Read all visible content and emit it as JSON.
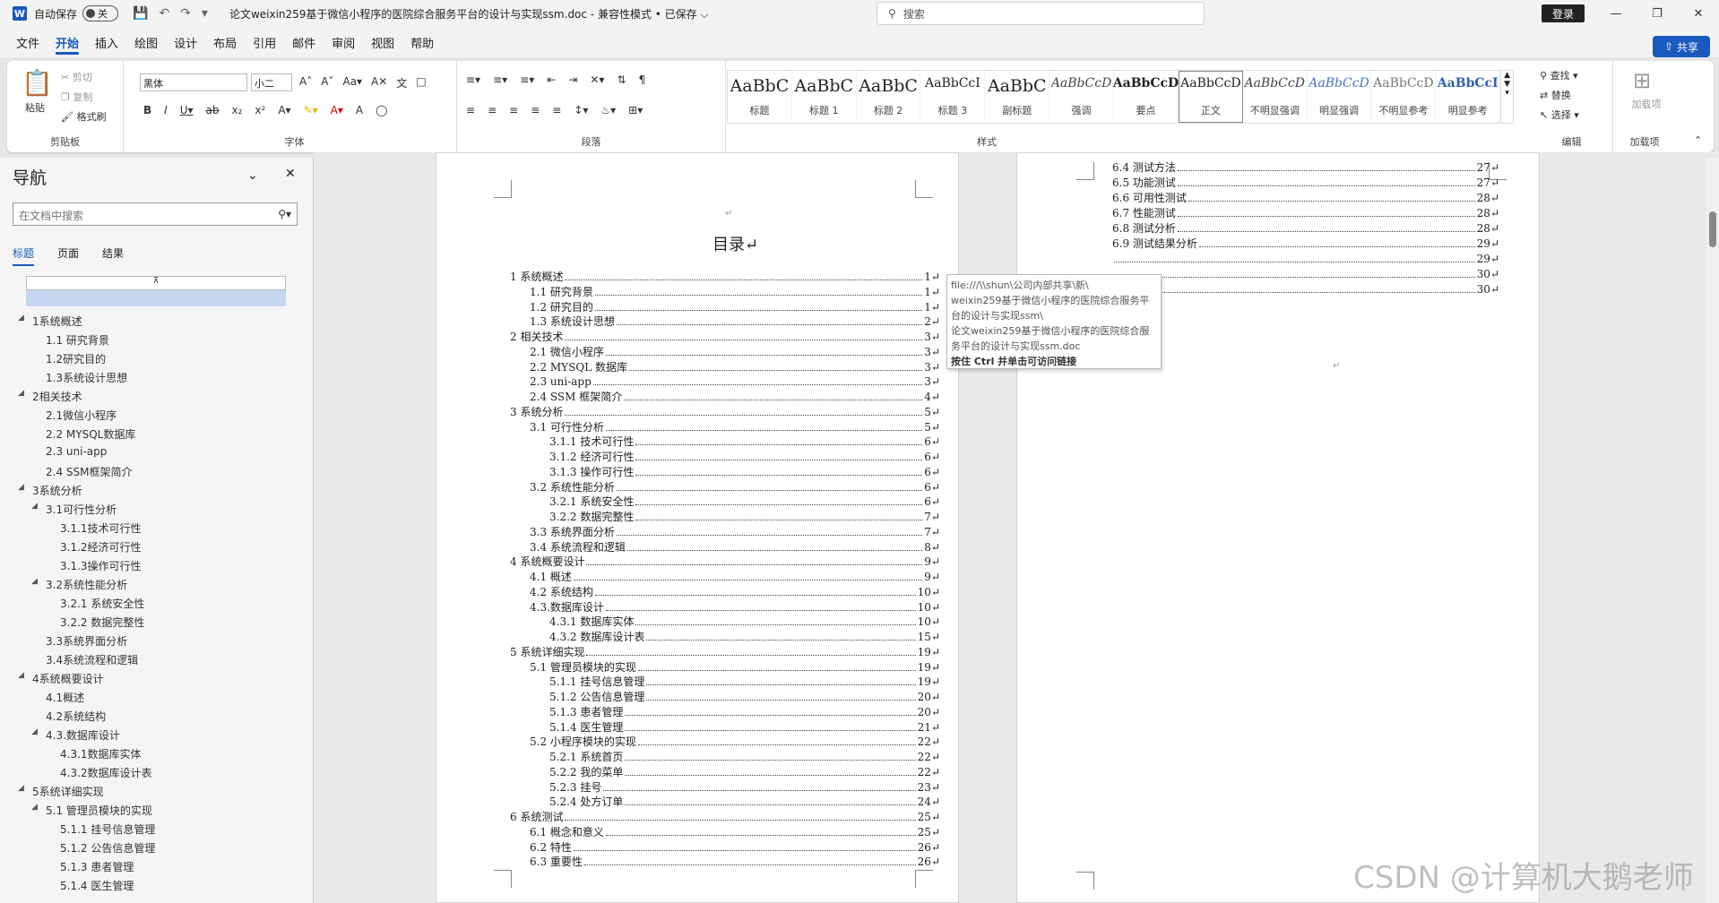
{
  "titlebar": {
    "autosave_label": "自动保存",
    "autosave_state": "关",
    "doc_title": "论文weixin259基于微信小程序的医院综合服务平台的设计与实现ssm.doc  -  兼容性模式 • 已保存 ⌵",
    "search_placeholder": "搜索",
    "login_label": "登录"
  },
  "menu": {
    "items": [
      "文件",
      "开始",
      "插入",
      "绘图",
      "设计",
      "布局",
      "引用",
      "邮件",
      "审阅",
      "视图",
      "帮助"
    ],
    "share_label": "共享"
  },
  "ribbon": {
    "clipboard": {
      "paste": "粘贴",
      "cut": "剪切",
      "copy": "复制",
      "format_painter": "格式刷",
      "label": "剪贴板"
    },
    "font": {
      "name": "黑体",
      "size": "小二",
      "label": "字体"
    },
    "paragraph": {
      "label": "段落"
    },
    "styles": {
      "label": "样式",
      "items": [
        {
          "sample": "AaBbC",
          "name": "标题"
        },
        {
          "sample": "AaBbC",
          "name": "标题 1"
        },
        {
          "sample": "AaBbC",
          "name": "标题 2"
        },
        {
          "sample": "AaBbCcI",
          "name": "标题 3"
        },
        {
          "sample": "AaBbC",
          "name": "副标题"
        },
        {
          "sample": "AaBbCcD",
          "name": "强调"
        },
        {
          "sample": "AaBbCcD",
          "name": "要点"
        },
        {
          "sample": "AaBbCcD",
          "name": "正文"
        },
        {
          "sample": "AaBbCcD",
          "name": "不明显强调"
        },
        {
          "sample": "AaBbCcD",
          "name": "明显强调"
        },
        {
          "sample": "AaBbCcD",
          "name": "不明显参考"
        },
        {
          "sample": "AaBbCcI",
          "name": "明显参考"
        }
      ]
    },
    "editing": {
      "find": "查找",
      "replace": "替换",
      "select": "选择",
      "label": "编辑"
    },
    "addins": {
      "btn": "加载项",
      "label": "加载项"
    }
  },
  "nav": {
    "title": "导航",
    "search_placeholder": "在文档中搜索",
    "tabs": [
      "标题",
      "页面",
      "结果"
    ],
    "items": [
      {
        "label": "1系统概述",
        "level": 1
      },
      {
        "label": "1.1 研究背景",
        "level": 2
      },
      {
        "label": "1.2研究目的",
        "level": 2
      },
      {
        "label": "1.3系统设计思想",
        "level": 2
      },
      {
        "label": "2相关技术",
        "level": 1
      },
      {
        "label": "2.1微信小程序",
        "level": 2
      },
      {
        "label": "2.2 MYSQL数据库",
        "level": 2
      },
      {
        "label": "2.3 uni-app",
        "level": 2
      },
      {
        "label": "2.4 SSM框架简介",
        "level": 2
      },
      {
        "label": "3系统分析",
        "level": 1
      },
      {
        "label": "3.1可行性分析",
        "level": 2
      },
      {
        "label": "3.1.1技术可行性",
        "level": 3
      },
      {
        "label": "3.1.2经济可行性",
        "level": 3
      },
      {
        "label": "3.1.3操作可行性",
        "level": 3
      },
      {
        "label": "3.2系统性能分析",
        "level": 2
      },
      {
        "label": "3.2.1 系统安全性",
        "level": 3
      },
      {
        "label": "3.2.2 数据完整性",
        "level": 3
      },
      {
        "label": "3.3系统界面分析",
        "level": 2
      },
      {
        "label": "3.4系统流程和逻辑",
        "level": 2
      },
      {
        "label": "4系统概要设计",
        "level": 1
      },
      {
        "label": "4.1概述",
        "level": 2
      },
      {
        "label": "4.2系统结构",
        "level": 2
      },
      {
        "label": "4.3.数据库设计",
        "level": 2
      },
      {
        "label": "4.3.1数据库实体",
        "level": 3
      },
      {
        "label": "4.3.2数据库设计表",
        "level": 3
      },
      {
        "label": "5系统详细实现",
        "level": 1
      },
      {
        "label": "5.1 管理员模块的实现",
        "level": 2
      },
      {
        "label": "5.1.1 挂号信息管理",
        "level": 3
      },
      {
        "label": "5.1.2 公告信息管理",
        "level": 3
      },
      {
        "label": "5.1.3 患者管理",
        "level": 3
      },
      {
        "label": "5.1.4 医生管理",
        "level": 3
      }
    ]
  },
  "page1": {
    "title": "目录↵",
    "toc": [
      {
        "t": "1 系统概述",
        "p": "1↵",
        "l": 1
      },
      {
        "t": "1.1  研究背景",
        "p": "1↵",
        "l": 2
      },
      {
        "t": "1.2 研究目的",
        "p": "1↵",
        "l": 2
      },
      {
        "t": "1.3 系统设计思想",
        "p": "2↵",
        "l": 2
      },
      {
        "t": "2 相关技术",
        "p": "3↵",
        "l": 1
      },
      {
        "t": "2.1 微信小程序",
        "p": "3↵",
        "l": 2
      },
      {
        "t": "2.2 MYSQL 数据库",
        "p": "3↵",
        "l": 2
      },
      {
        "t": "2.3 uni-app",
        "p": "3↵",
        "l": 2
      },
      {
        "t": "2.4 SSM 框架简介",
        "p": "4↵",
        "l": 2
      },
      {
        "t": "3 系统分析",
        "p": "5↵",
        "l": 1
      },
      {
        "t": "3.1 可行性分析",
        "p": "5↵",
        "l": 2
      },
      {
        "t": "3.1.1 技术可行性",
        "p": "6↵",
        "l": 3
      },
      {
        "t": "3.1.2 经济可行性",
        "p": "6↵",
        "l": 3
      },
      {
        "t": "3.1.3 操作可行性",
        "p": "6↵",
        "l": 3
      },
      {
        "t": "3.2 系统性能分析",
        "p": "6↵",
        "l": 2
      },
      {
        "t": "3.2.1  系统安全性",
        "p": "6↵",
        "l": 3
      },
      {
        "t": "3.2.2  数据完整性",
        "p": "7↵",
        "l": 3
      },
      {
        "t": "3.3 系统界面分析",
        "p": "7↵",
        "l": 2
      },
      {
        "t": "3.4 系统流程和逻辑",
        "p": "8↵",
        "l": 2
      },
      {
        "t": "4 系统概要设计",
        "p": "9↵",
        "l": 1
      },
      {
        "t": "4.1 概述",
        "p": "9↵",
        "l": 2
      },
      {
        "t": "4.2 系统结构",
        "p": "10↵",
        "l": 2
      },
      {
        "t": "4.3.数据库设计",
        "p": "10↵",
        "l": 2
      },
      {
        "t": "4.3.1 数据库实体",
        "p": "10↵",
        "l": 3
      },
      {
        "t": "4.3.2 数据库设计表",
        "p": "15↵",
        "l": 3
      },
      {
        "t": "5 系统详细实现",
        "p": "19↵",
        "l": 1
      },
      {
        "t": "5.1  管理员模块的实现",
        "p": "19↵",
        "l": 2
      },
      {
        "t": "5.1.1  挂号信息管理",
        "p": "19↵",
        "l": 3
      },
      {
        "t": "5.1.2  公告信息管理",
        "p": "20↵",
        "l": 3
      },
      {
        "t": "5.1.3  患者管理",
        "p": "20↵",
        "l": 3
      },
      {
        "t": "5.1.4  医生管理",
        "p": "21↵",
        "l": 3
      },
      {
        "t": "5.2  小程序模块的实现",
        "p": "22↵",
        "l": 2
      },
      {
        "t": "5.2.1  系统首页",
        "p": "22↵",
        "l": 3
      },
      {
        "t": "5.2.2  我的菜单",
        "p": "22↵",
        "l": 3
      },
      {
        "t": "5.2.3  挂号",
        "p": "23↵",
        "l": 3
      },
      {
        "t": "5.2.4  处方订单",
        "p": "24↵",
        "l": 3
      },
      {
        "t": "6 系统测试",
        "p": "25↵",
        "l": 1
      },
      {
        "t": "6.1 概念和意义",
        "p": "25↵",
        "l": 2
      },
      {
        "t": "6.2 特性",
        "p": "26↵",
        "l": 2
      },
      {
        "t": "6.3 重要性",
        "p": "26↵",
        "l": 2
      }
    ]
  },
  "page2": {
    "toc": [
      {
        "t": "6.4 测试方法",
        "p": "27↵"
      },
      {
        "t": "6.5  功能测试",
        "p": "27↵"
      },
      {
        "t": "6.6 可用性测试",
        "p": "28↵"
      },
      {
        "t": "6.7 性能测试",
        "p": "28↵"
      },
      {
        "t": "6.8 测试分析",
        "p": "28↵"
      },
      {
        "t": "6.9 测试结果分析",
        "p": "29↵"
      },
      {
        "t": "",
        "p": "29↵"
      },
      {
        "t": "",
        "p": "30↵"
      },
      {
        "t": "",
        "p": "30↵"
      }
    ]
  },
  "tooltip": {
    "lines": [
      "file:///\\\\shun\\公司内部共享\\新\\",
      "weixin259基于微信小程序的医院综合服务平",
      "台的设计与实现ssm\\",
      "论文weixin259基于微信小程序的医院综合服",
      "务平台的设计与实现ssm.doc"
    ],
    "hint": "按住 Ctrl 并单击可访问链接"
  },
  "watermark": "CSDN @计算机大鹅老师"
}
